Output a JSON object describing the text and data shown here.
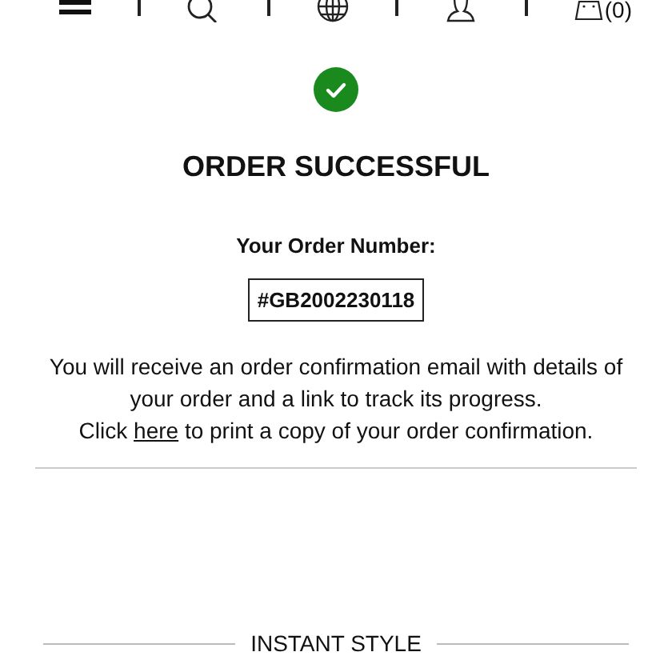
{
  "header": {
    "cart_count": "(0)"
  },
  "status": {
    "kind": "success"
  },
  "title": "ORDER SUCCESSFUL",
  "order_number_label": "Your Order Number:",
  "order_number": "#GB2002230118",
  "message": "You will receive an order confirmation email with details of your order and a link to track its progress.",
  "print_note": {
    "before": "Click",
    "link": "here",
    "after": "to print a copy of your order confirmation."
  },
  "section_heading": "INSTANT STYLE"
}
